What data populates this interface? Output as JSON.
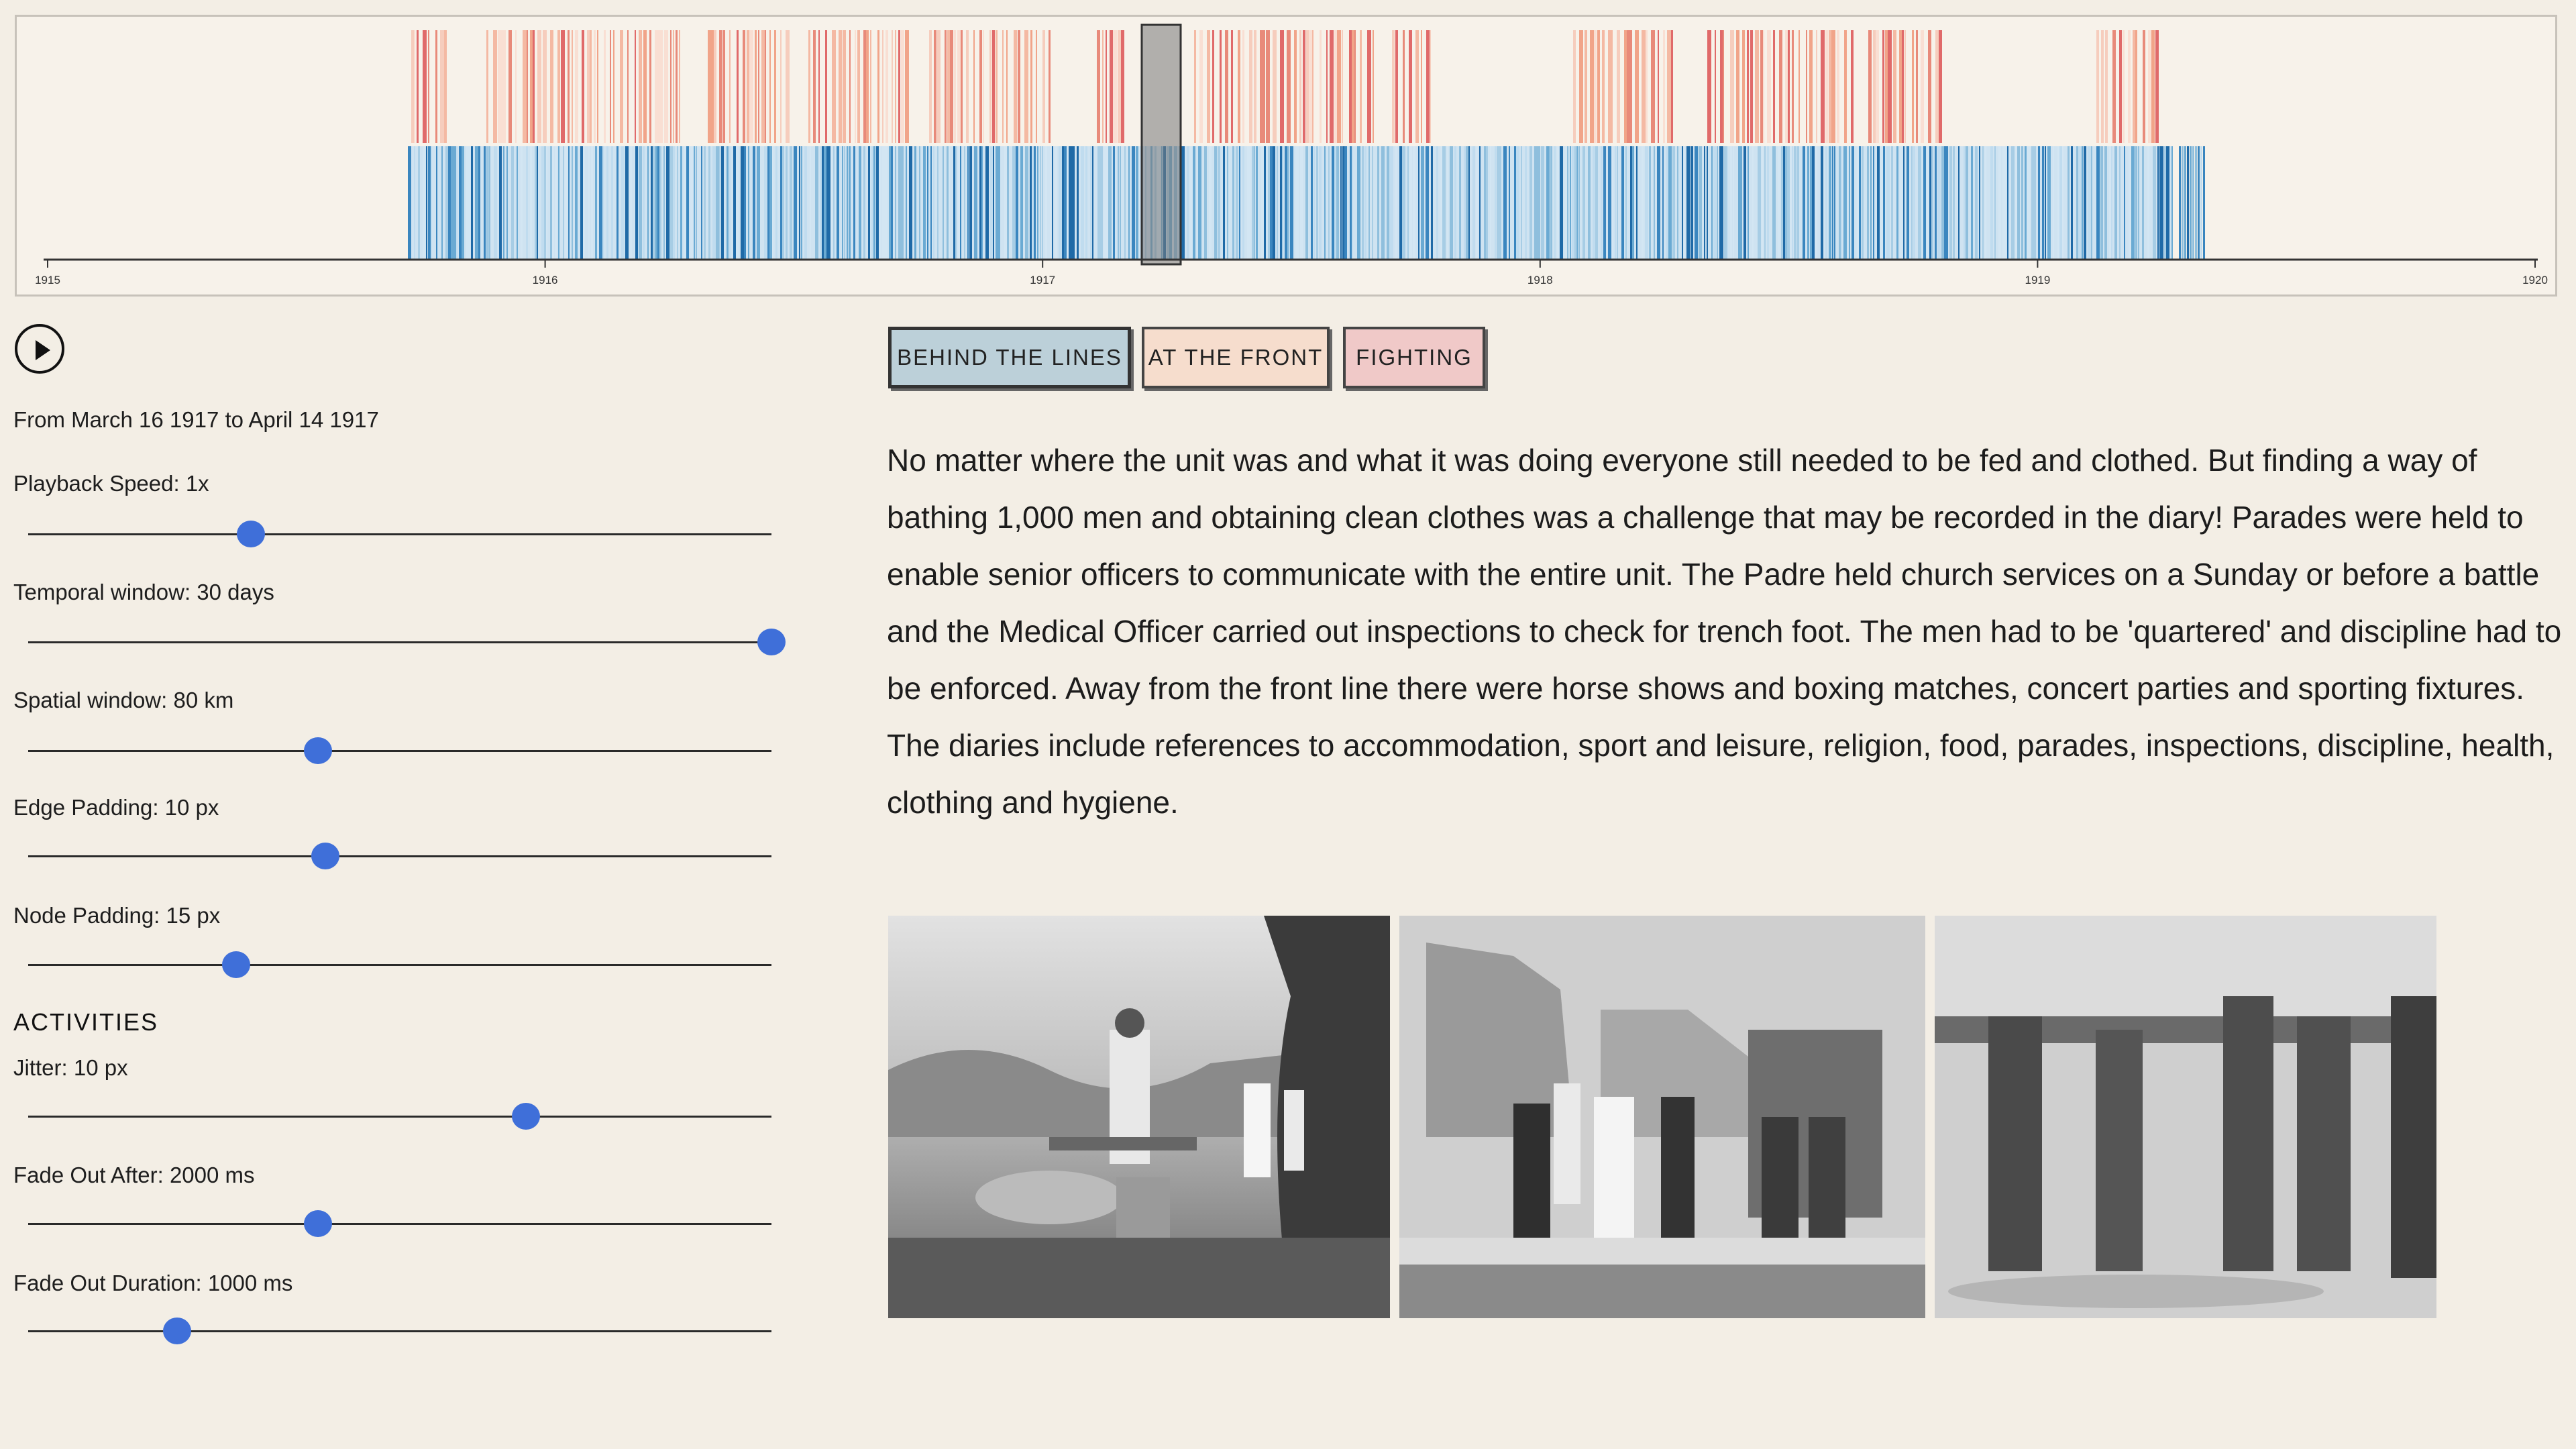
{
  "timeline": {
    "axis_ticks": [
      "1915",
      "1916",
      "1917",
      "1918",
      "1919",
      "1920"
    ],
    "colors": {
      "behind_the_lines": "#2b7bb5",
      "at_the_front": "#f1a489",
      "fighting": "#e06a6a",
      "brush": "#888888"
    },
    "selected_range": {
      "from": "1917-03-16",
      "to": "1917-04-14"
    }
  },
  "controls": {
    "play_icon": "play-icon",
    "date_range": "From March 16 1917 to April 14 1917",
    "playback_speed": {
      "label": "Playback Speed: 1x",
      "value": 0.3
    },
    "temporal_window": {
      "label": "Temporal window: 30 days",
      "value": 1.0
    },
    "spatial_window": {
      "label": "Spatial window: 80 km",
      "value": 0.39
    },
    "edge_padding": {
      "label": "Edge Padding: 10 px",
      "value": 0.4
    },
    "node_padding": {
      "label": "Node Padding: 15 px",
      "value": 0.28
    },
    "activities_heading": "ACTIVITIES",
    "jitter": {
      "label": "Jitter: 10 px",
      "value": 0.67
    },
    "fade_out_after": {
      "label": "Fade Out After: 2000 ms",
      "value": 0.39
    },
    "fade_out_duration": {
      "label": "Fade Out Duration: 1000 ms",
      "value": 0.2
    }
  },
  "categories": {
    "behind": "BEHIND THE LINES",
    "front": "AT THE FRONT",
    "fighting": "FIGHTING"
  },
  "description": "No matter where the unit was and what it was doing everyone still needed to be fed and clothed. But finding a way of bathing 1,000 men and obtaining clean clothes was a challenge that may be recorded in the diary! Parades were held to enable senior officers to communicate with the entire unit. The Padre held church services on a Sunday or before a battle and the Medical Officer carried out inspections to check for trench foot. The men had to be 'quartered' and discipline had to be enforced. Away from the front line there were horse shows and boxing matches, concert parties and sporting fixtures. The diaries include references to accommodation, sport and leisure, religion, food, parades, inspections, discipline, health, clothing and hygiene."
}
